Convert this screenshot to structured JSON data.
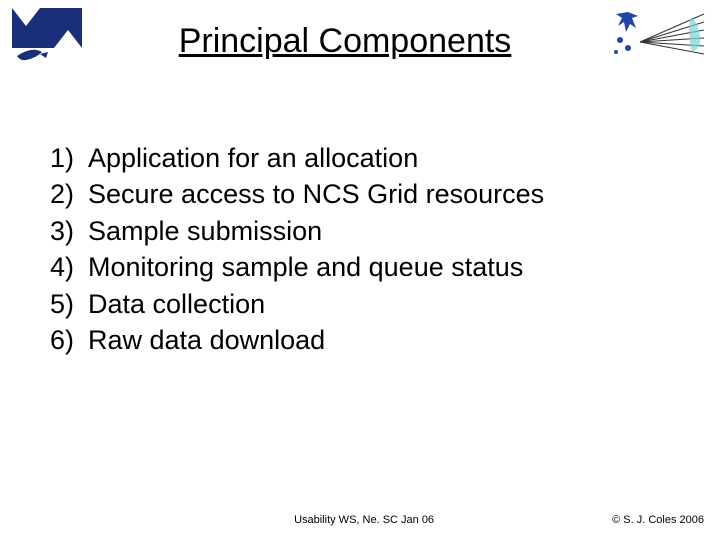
{
  "header": {
    "title": "Principal Components"
  },
  "list": {
    "items": [
      {
        "marker": "1)",
        "text": "Application for an allocation"
      },
      {
        "marker": "2)",
        "text": "Secure access to NCS Grid resources"
      },
      {
        "marker": "3)",
        "text": "Sample submission"
      },
      {
        "marker": "4)",
        "text": "Monitoring sample and queue status"
      },
      {
        "marker": "5)",
        "text": "Data collection"
      },
      {
        "marker": "6)",
        "text": "Raw data download"
      }
    ]
  },
  "footer": {
    "center": "Usability WS, Ne. SC Jan 06",
    "right": "© S. J. Coles 2006"
  }
}
